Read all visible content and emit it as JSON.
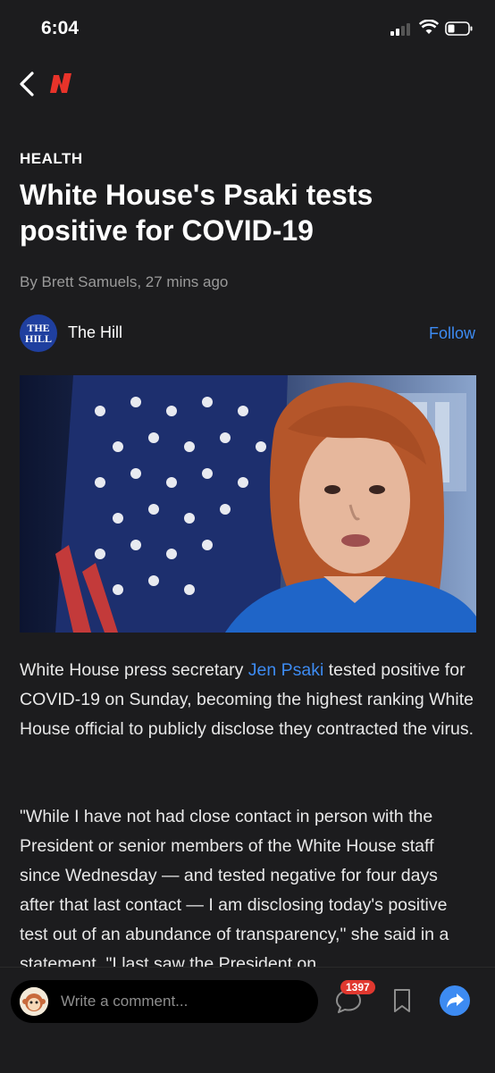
{
  "status_bar": {
    "time": "6:04"
  },
  "article": {
    "category": "HEALTH",
    "headline": "White House's Psaki tests positive for COVID-19",
    "byline": "By Brett Samuels, 27 mins ago",
    "source": {
      "logo_text_top": "THE",
      "logo_text_bottom": "HILL",
      "name": "The Hill",
      "follow_label": "Follow"
    },
    "paragraph1": {
      "before": "White House press secretary ",
      "link": "Jen Psaki",
      "after": " tested positive for COVID-19 on Sunday, becoming the highest ranking White House official to publicly disclose they contracted the virus."
    },
    "paragraph2": "\"While I have not had close contact in person with the President or senior members of the White House staff since Wednesday — and tested negative for four days after that last contact — I am disclosing today's positive test out of an abundance of transparency,\" she said in a statement. \"I last saw the President on"
  },
  "bottom_bar": {
    "comment_placeholder": "Write a comment...",
    "comment_count": "1397"
  },
  "colors": {
    "accent": "#3d8bf2",
    "badge": "#e0382f",
    "background": "#1c1c1e"
  },
  "icons": [
    "back-icon",
    "newsbreak-logo",
    "comment-icon",
    "bookmark-icon",
    "share-icon",
    "wifi-icon",
    "battery-icon",
    "signal-icon"
  ]
}
